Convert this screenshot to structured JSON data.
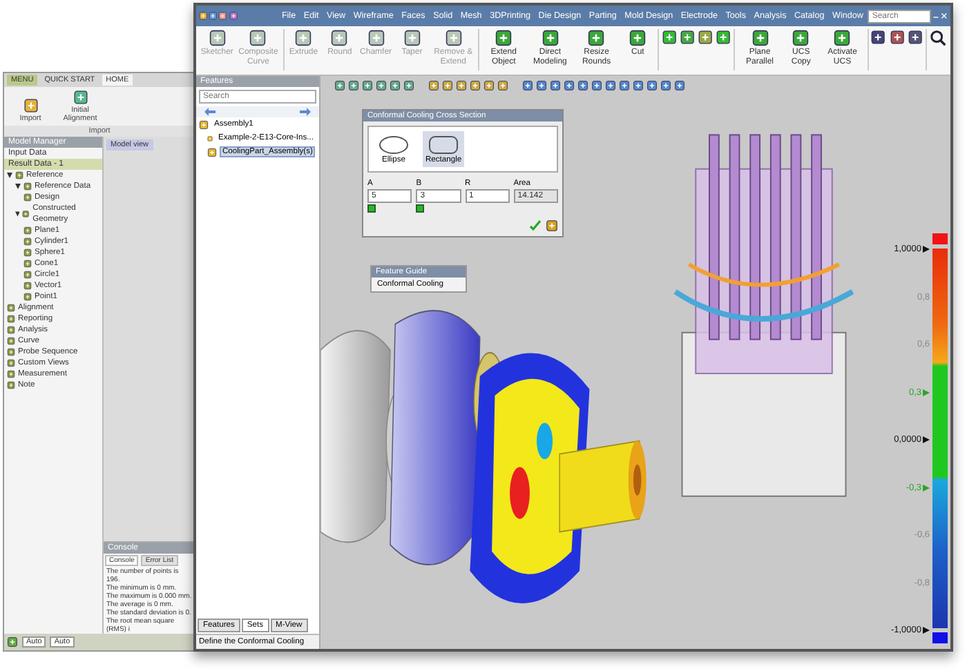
{
  "back_window": {
    "ribbon_tabs": [
      {
        "label": "MENU",
        "selected": false
      },
      {
        "label": "QUICK START",
        "selected": false
      },
      {
        "label": "HOME",
        "selected": true
      }
    ],
    "ribbon_buttons": [
      "Import",
      "Initial Alignment"
    ],
    "ribbon_group": "Import",
    "panel_title": "Model Manager",
    "input_data": "Input Data",
    "result_data": "Result Data - 1",
    "tree": [
      {
        "label": "Reference",
        "expanded": true,
        "children": [
          {
            "label": "Reference Data",
            "expanded": true,
            "children": [
              {
                "label": "Design"
              }
            ]
          },
          {
            "label": "Constructed Geometry",
            "expanded": true,
            "children": [
              {
                "label": "Plane1"
              },
              {
                "label": "Cylinder1"
              },
              {
                "label": "Sphere1"
              },
              {
                "label": "Cone1"
              },
              {
                "label": "Circle1"
              },
              {
                "label": "Vector1"
              },
              {
                "label": "Point1"
              }
            ]
          }
        ]
      },
      {
        "label": "Alignment"
      },
      {
        "label": "Reporting"
      },
      {
        "label": "Analysis"
      },
      {
        "label": "Curve"
      },
      {
        "label": "Probe Sequence"
      },
      {
        "label": "Custom Views"
      },
      {
        "label": "Measurement"
      },
      {
        "label": "Note"
      }
    ],
    "view_tab": "Model view",
    "console_title": "Console",
    "console_tabs": [
      {
        "label": "Console",
        "selected": true
      },
      {
        "label": "Error List",
        "selected": false
      }
    ],
    "console_lines": [
      "The number of points is 196.",
      "The minimum is 0 mm.",
      "The maximum is 0.000 mm.",
      "The average is 0 mm.",
      "The standard deviation is 0.",
      "The root mean square (RMS) i"
    ],
    "status_selects": [
      "Auto",
      "Auto"
    ]
  },
  "main_window": {
    "menu": [
      "File",
      "Edit",
      "View",
      "Wireframe",
      "Faces",
      "Solid",
      "Mesh",
      "3DPrinting",
      "Die Design",
      "Parting",
      "Mold Design",
      "Electrode",
      "Tools",
      "Analysis",
      "Catalog",
      "Window"
    ],
    "search": {
      "placeholder": "Search"
    },
    "ribbon": [
      {
        "label": "Sketcher",
        "disabled": true
      },
      {
        "label": "Composite Curve",
        "disabled": true
      },
      {
        "label": "Extrude",
        "disabled": true
      },
      {
        "label": "Round",
        "disabled": true
      },
      {
        "label": "Chamfer",
        "disabled": true
      },
      {
        "label": "Taper",
        "disabled": true
      },
      {
        "label": "Remove & Extend",
        "disabled": true
      },
      {
        "label": "Extend Object",
        "disabled": false
      },
      {
        "label": "Direct Modeling",
        "disabled": false
      },
      {
        "label": "Resize Rounds",
        "disabled": false
      },
      {
        "label": "Cut",
        "disabled": false
      },
      {
        "label": "Plane Parallel",
        "disabled": false
      },
      {
        "label": "UCS Copy",
        "disabled": false
      },
      {
        "label": "Activate UCS",
        "disabled": false
      }
    ],
    "features_panel": {
      "title": "Features",
      "search": {
        "placeholder": "Search"
      },
      "tree": [
        {
          "label": "Assembly1",
          "selected": false,
          "children": [
            {
              "label": "Example-2-E13-Core-Ins...",
              "selected": false
            },
            {
              "label": "CoolingPart_Assembly(s)",
              "selected": true
            }
          ]
        }
      ],
      "tabs": [
        {
          "label": "Features",
          "selected": false
        },
        {
          "label": "Sets",
          "selected": true
        },
        {
          "label": "M-View",
          "selected": false
        }
      ]
    },
    "status": "Define the Conformal Cooling",
    "dialog": {
      "title": "Conformal Cooling Cross Section",
      "shapes": [
        {
          "label": "Ellipse",
          "selected": false
        },
        {
          "label": "Rectangle",
          "selected": true
        }
      ],
      "fields": [
        {
          "label": "A",
          "value": "5",
          "checked": true,
          "disabled": false
        },
        {
          "label": "B",
          "value": "3",
          "checked": true,
          "disabled": false
        },
        {
          "label": "R",
          "value": "1",
          "checked": false,
          "disabled": false
        },
        {
          "label": "Area",
          "value": "14.142",
          "checked": false,
          "disabled": true
        }
      ]
    },
    "feature_guide": {
      "title": "Feature Guide",
      "item": "Conformal Cooling"
    },
    "legend": [
      {
        "text": "1,0000",
        "kind": "limit"
      },
      {
        "text": "0,8",
        "kind": "tick"
      },
      {
        "text": "0,6",
        "kind": "tick"
      },
      {
        "text": "0,3",
        "kind": "range"
      },
      {
        "text": "0,0000",
        "kind": "limit"
      },
      {
        "text": "-0,3",
        "kind": "range"
      },
      {
        "text": "-0,6",
        "kind": "tick"
      },
      {
        "text": "-0,8",
        "kind": "tick"
      },
      {
        "text": "-1,0000",
        "kind": "limit"
      }
    ]
  }
}
